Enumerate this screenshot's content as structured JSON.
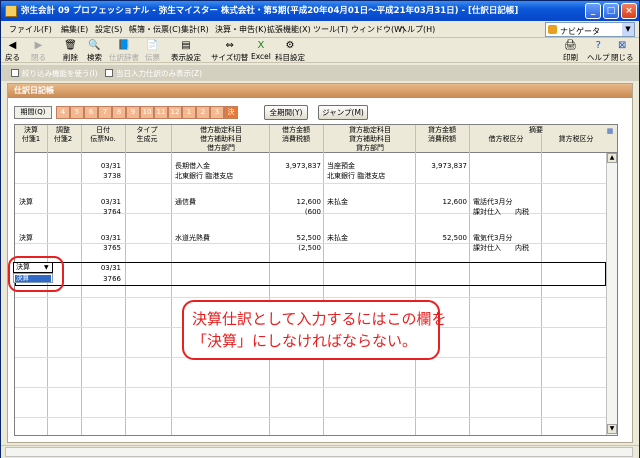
{
  "window": {
    "title": "弥生会計 09 プロフェッショナル - 弥生マイスター 株式会社・第5期(平成20年04月01日～平成21年03月31日) - [仕訳日記帳]",
    "min_label": "_",
    "max_label": "□",
    "close_label": "×"
  },
  "menu": {
    "items": [
      "ファイル(F)",
      "編集(E)",
      "設定(S)",
      "帳簿・伝票(C)",
      "集計(R)",
      "決算・申告(K)",
      "拡張機能(X)",
      "ツール(T)",
      "ウィンドウ(W)",
      "ヘルプ(H)"
    ],
    "navi_label": "ナビゲータ"
  },
  "toolbar": {
    "left": [
      "戻る",
      "閉る",
      "削除",
      "検索",
      "仕訳辞書",
      "伝票",
      "表示設定",
      "サイズ切替",
      "Excel",
      "科目設定"
    ],
    "right": [
      "印刷",
      "ヘルプ",
      "閉じる"
    ]
  },
  "options": {
    "filter_label": "絞り込み機能を使う(I)",
    "today_label": "当日入力仕訳のみ表示(Z)"
  },
  "section": {
    "title": "仕訳日記帳"
  },
  "periods": {
    "label": "期間(Q)",
    "months": [
      "4",
      "5",
      "6",
      "7",
      "8",
      "9",
      "10",
      "11",
      "12",
      "1",
      "2",
      "3",
      "決"
    ],
    "all_label": "全期間(Y)",
    "jump_label": "ジャンプ(M)"
  },
  "grid": {
    "headers": {
      "kessan": "決算",
      "chosei": "調整",
      "hizuke": "日付",
      "type": "タイプ",
      "fusen1": "付箋1",
      "fusen2": "付箋2",
      "denpyo": "伝票No.",
      "seisei": "生成元",
      "debit_account": "借方勘定科目",
      "debit_sub": "借方補助科目",
      "debit_dept": "借方部門",
      "debit_amount": "借方金額",
      "debit_tax": "消費税額",
      "credit_account": "貸方勘定科目",
      "credit_sub": "貸方補助科目",
      "credit_dept": "貸方部門",
      "credit_amount": "貸方金額",
      "credit_tax": "消費税額",
      "summary": "摘要",
      "debit_taxclass": "借方税区分",
      "credit_taxclass": "貸方税区分"
    },
    "rows": [
      {
        "kessan": "",
        "date": "03/31",
        "no": "3738",
        "debit_account": "長期借入金",
        "debit_sub": "北東銀行 臨港支店",
        "debit_amount": "3,973,837",
        "debit_tax": "",
        "credit_account": "当座預金",
        "credit_sub": "北東銀行 臨港支店",
        "credit_amount": "3,973,837",
        "credit_tax": "",
        "summary": "",
        "debit_taxclass": "",
        "credit_taxclass": ""
      },
      {
        "kessan": "決算",
        "date": "03/31",
        "no": "3764",
        "debit_account": "通信費",
        "debit_sub": "",
        "debit_amount": "12,600",
        "debit_tax": "(600",
        "credit_account": "未払金",
        "credit_sub": "",
        "credit_amount": "12,600",
        "credit_tax": "",
        "summary": "電話代3月分",
        "debit_taxclass": "課対仕入",
        "credit_taxclass": "内税"
      },
      {
        "kessan": "決算",
        "date": "03/31",
        "no": "3765",
        "debit_account": "水道光熱費",
        "debit_sub": "",
        "debit_amount": "52,500",
        "debit_tax": "(2,500",
        "credit_account": "未払金",
        "credit_sub": "",
        "credit_amount": "52,500",
        "credit_tax": "",
        "summary": "電気代3月分",
        "debit_taxclass": "課対仕入",
        "credit_taxclass": "内税"
      },
      {
        "kessan": "決算",
        "date": "03/31",
        "no": "3766",
        "debit_account": "",
        "debit_sub": "",
        "debit_amount": "",
        "debit_tax": "",
        "credit_account": "",
        "credit_sub": "",
        "credit_amount": "",
        "credit_tax": "",
        "summary": "",
        "debit_taxclass": "",
        "credit_taxclass": ""
      }
    ],
    "combo_option": "決算"
  },
  "callout": {
    "line1": "決算仕訳として入力するにはこの欄を",
    "line2": "「決算」にしなければならない。"
  },
  "colors": {
    "annotation": "#e82020",
    "accent": "#c88850"
  }
}
